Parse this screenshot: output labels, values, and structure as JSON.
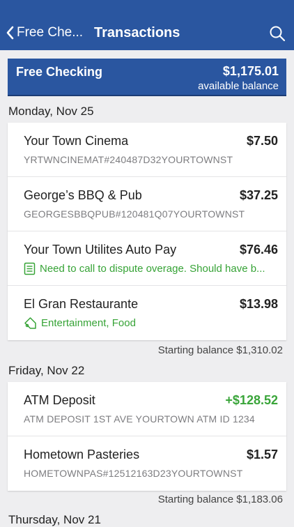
{
  "nav": {
    "back_label": "Free Che...",
    "title": "Transactions"
  },
  "account": {
    "name": "Free Checking",
    "balance": "$1,175.01",
    "balance_label": "available balance"
  },
  "sections": [
    {
      "date": "Monday, Nov 25",
      "transactions": [
        {
          "name": "Your Town Cinema",
          "amount": "$7.50",
          "detail": "YRTWNCINEMAT#240487D32YOURTOWNST"
        },
        {
          "name": "George’s BBQ & Pub",
          "amount": "$37.25",
          "detail": "GEORGESBBQPUB#120481Q07YOURTOWNST"
        },
        {
          "name": "Your Town Utilites Auto Pay",
          "amount": "$76.46",
          "note": "Need to call to dispute overage. Should have b..."
        },
        {
          "name": "El Gran Restaurante",
          "amount": "$13.98",
          "tags": "Entertainment, Food"
        }
      ],
      "starting_balance": "Starting balance $1,310.02"
    },
    {
      "date": "Friday, Nov 22",
      "transactions": [
        {
          "name": "ATM Deposit",
          "amount": "+$128.52",
          "detail": "ATM DEPOSIT 1ST AVE YOURTOWN ATM ID 1234"
        },
        {
          "name": "Hometown Pasteries",
          "amount": "$1.57",
          "detail": "HOMETOWNPAS#12512163D23YOURTOWNST"
        }
      ],
      "starting_balance": "Starting balance $1,183.06"
    },
    {
      "date": "Thursday, Nov 21"
    }
  ],
  "colors": {
    "brand_blue": "#2a56a0",
    "credit_green": "#3aa53a",
    "note_green": "#36a336"
  },
  "icons": {
    "back": "chevron-left-icon",
    "search": "search-icon",
    "note": "note-icon",
    "tag": "tag-icon"
  }
}
